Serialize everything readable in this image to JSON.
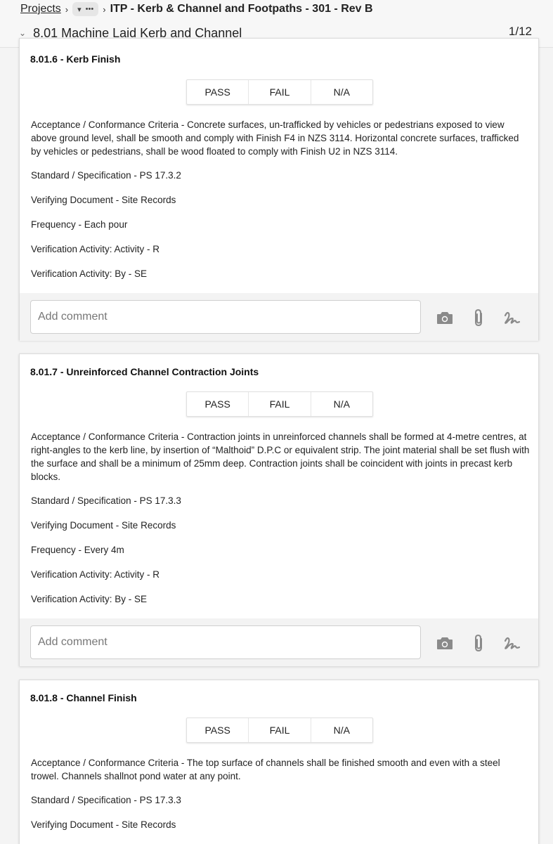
{
  "breadcrumb": {
    "projects": "Projects",
    "more": "•••",
    "current": "ITP - Kerb & Channel and Footpaths - 301 - Rev B"
  },
  "section": {
    "title": "8.01 Machine Laid Kerb and Channel",
    "count": "1/12"
  },
  "labels": {
    "pass": "PASS",
    "fail": "FAIL",
    "na": "N/A",
    "comment_placeholder": "Add comment"
  },
  "cards": [
    {
      "title": "8.01.6 - Kerb Finish",
      "criteria": "Acceptance / Conformance Criteria - Concrete surfaces, un-trafficked by vehicles or pedestrians exposed to view above ground level, shall be smooth and comply with Finish F4 in NZS 3114. Horizontal concrete surfaces, trafficked by vehicles or pedestrians, shall be wood floated to comply with Finish U2 in NZS 3114.",
      "standard": "Standard / Specification - PS 17.3.2",
      "document": "Verifying Document - Site Records",
      "frequency": "Frequency - Each pour",
      "activity": "Verification Activity: Activity - R",
      "by": "Verification Activity: By - SE"
    },
    {
      "title": "8.01.7 - Unreinforced Channel Contraction Joints",
      "criteria": "Acceptance / Conformance Criteria - Contraction joints in unreinforced channels shall be formed at 4-metre centres, at right-angles to the kerb line, by insertion of “Malthoid” D.P.C or equivalent strip. The joint material shall be set flush with the surface and shall be a minimum of 25mm deep. Contraction joints shall be coincident with joints in precast kerb blocks.",
      "standard": "Standard / Specification - PS 17.3.3",
      "document": "Verifying Document - Site Records",
      "frequency": "Frequency - Every 4m",
      "activity": "Verification Activity: Activity - R",
      "by": "Verification Activity: By - SE"
    },
    {
      "title": "8.01.8 - Channel Finish",
      "criteria": "Acceptance / Conformance Criteria - The top surface of channels shall be finished smooth and even with a steel trowel. Channels shallnot pond water at any point.",
      "standard": "Standard / Specification - PS 17.3.3",
      "document": "Verifying Document - Site Records"
    }
  ]
}
